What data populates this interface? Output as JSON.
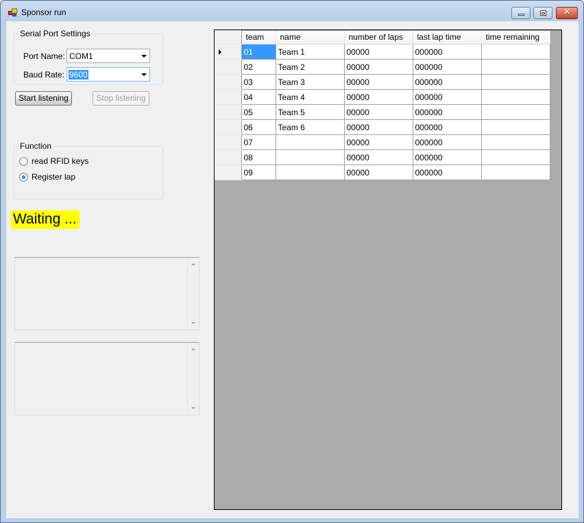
{
  "window": {
    "title": "Sponsor run",
    "controls": {
      "minimize": "minimize",
      "maximize": "maximize",
      "close": "✕"
    }
  },
  "serial_port_settings": {
    "legend": "Serial Port Settings",
    "port_name_label": "Port Name:",
    "port_name_value": "COM1",
    "baud_rate_label": "Baud Rate:",
    "baud_rate_value": "9600"
  },
  "buttons": {
    "start": "Start listening",
    "stop": "Stop listening"
  },
  "function_group": {
    "legend": "Function",
    "options": [
      {
        "label": "read RFID keys",
        "checked": false
      },
      {
        "label": "Register lap",
        "checked": true
      }
    ]
  },
  "status_text": "Waiting ...",
  "colors": {
    "status_highlight": "#ffff00",
    "selection": "#3399ff",
    "grid_background": "#ababab"
  },
  "grid": {
    "columns": [
      "team",
      "name",
      "number of laps",
      "last lap time",
      "time remaining"
    ],
    "rows": [
      {
        "team": "01",
        "name": "Team 1",
        "laps": "00000",
        "last": "000000",
        "remaining": "",
        "current": true
      },
      {
        "team": "02",
        "name": "Team 2",
        "laps": "00000",
        "last": "000000",
        "remaining": ""
      },
      {
        "team": "03",
        "name": "Team 3",
        "laps": "00000",
        "last": "000000",
        "remaining": ""
      },
      {
        "team": "04",
        "name": "Team 4",
        "laps": "00000",
        "last": "000000",
        "remaining": ""
      },
      {
        "team": "05",
        "name": "Team 5",
        "laps": "00000",
        "last": "000000",
        "remaining": ""
      },
      {
        "team": "06",
        "name": "Team 6",
        "laps": "00000",
        "last": "000000",
        "remaining": ""
      },
      {
        "team": "07",
        "name": "",
        "laps": "00000",
        "last": "000000",
        "remaining": ""
      },
      {
        "team": "08",
        "name": "",
        "laps": "00000",
        "last": "000000",
        "remaining": ""
      },
      {
        "team": "09",
        "name": "",
        "laps": "00000",
        "last": "000000",
        "remaining": ""
      }
    ]
  }
}
